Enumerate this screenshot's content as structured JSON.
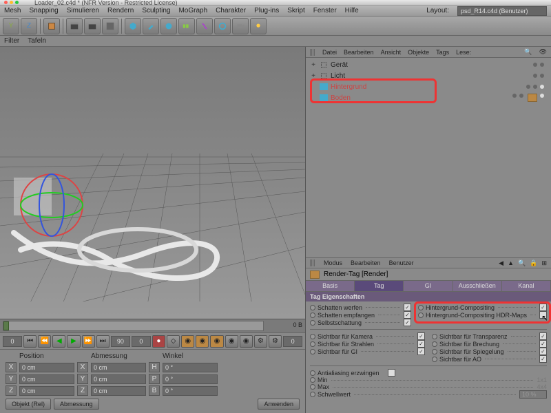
{
  "title": "Loader_02.c4d * (NFR Version - Restricted License)",
  "menu": [
    "Mesh",
    "Snapping",
    "Simulieren",
    "Rendern",
    "Sculpting",
    "MoGraph",
    "Charakter",
    "Plug-ins",
    "Skript",
    "Fenster",
    "Hilfe"
  ],
  "layout_label": "Layout:",
  "layout_value": "psd_R14.c4d (Benutzer)",
  "filterbar": {
    "filter": "Filter",
    "tafeln": "Tafeln"
  },
  "timeline": {
    "start": "0",
    "range": "0 B",
    "f1": "0",
    "f2": "90",
    "f3": "0",
    "f4": "0"
  },
  "coords": {
    "hdr": {
      "pos": "Position",
      "abm": "Abmessung",
      "wnk": "Winkel"
    },
    "rows": [
      {
        "a": "X",
        "av": "0 cm",
        "b": "X",
        "bv": "0 cm",
        "c": "H",
        "cv": "0 °"
      },
      {
        "a": "Y",
        "av": "0 cm",
        "b": "Y",
        "bv": "0 cm",
        "c": "P",
        "cv": "0 °"
      },
      {
        "a": "Z",
        "av": "0 cm",
        "b": "Z",
        "bv": "0 cm",
        "c": "B",
        "cv": "0 °"
      }
    ],
    "btn1": "Objekt (Rel)",
    "btn2": "Abmessung",
    "btn3": "Anwenden"
  },
  "obj_menu": [
    "Datei",
    "Bearbeiten",
    "Ansicht",
    "Objekte",
    "Tags",
    "Lese:"
  ],
  "objects": [
    {
      "exp": "+",
      "name": "Gerät",
      "sel": false,
      "tags": 0
    },
    {
      "exp": "+",
      "name": "Licht",
      "sel": false,
      "tags": 0
    },
    {
      "exp": "",
      "name": "Hintergrund",
      "sel": true,
      "tags": 1
    },
    {
      "exp": "",
      "name": "Boden",
      "sel": true,
      "tags": 2
    }
  ],
  "attr_menu": [
    "Modus",
    "Bearbeiten",
    "Benutzer"
  ],
  "attr_title": "Render-Tag [Render]",
  "attr_tabs": [
    "Basis",
    "Tag",
    "GI",
    "Ausschließen",
    "Kanal"
  ],
  "attr_section": "Tag Eigenschaften",
  "props_left1": [
    {
      "l": "Schatten werfen",
      "c": true
    },
    {
      "l": "Schatten empfangen",
      "c": true
    },
    {
      "l": "Selbstschattung",
      "c": true
    }
  ],
  "props_right1": [
    {
      "l": "Hintergrund-Compositing",
      "c": true
    },
    {
      "l": "Hintergrund-Compositing HDR-Maps",
      "c": false
    }
  ],
  "props_left2": [
    {
      "l": "Sichtbar für Kamera",
      "c": true
    },
    {
      "l": "Sichtbar für Strahlen",
      "c": true
    },
    {
      "l": "Sichtbar für GI",
      "c": true
    }
  ],
  "props_right2": [
    {
      "l": "Sichtbar für Transparenz",
      "c": true
    },
    {
      "l": "Sichtbar für Brechung",
      "c": true
    },
    {
      "l": "Sichtbar für Spiegelung",
      "c": true
    },
    {
      "l": "Sichtbar für AO",
      "c": true
    }
  ],
  "props_bottom": [
    {
      "l": "Antialiasing erzwingen",
      "t": "chk",
      "c": false
    },
    {
      "l": "Min",
      "t": "val",
      "v": "1x1"
    },
    {
      "l": "Max",
      "t": "val",
      "v": "4x4"
    },
    {
      "l": "Schwellwert",
      "t": "in",
      "v": "10 %"
    }
  ]
}
